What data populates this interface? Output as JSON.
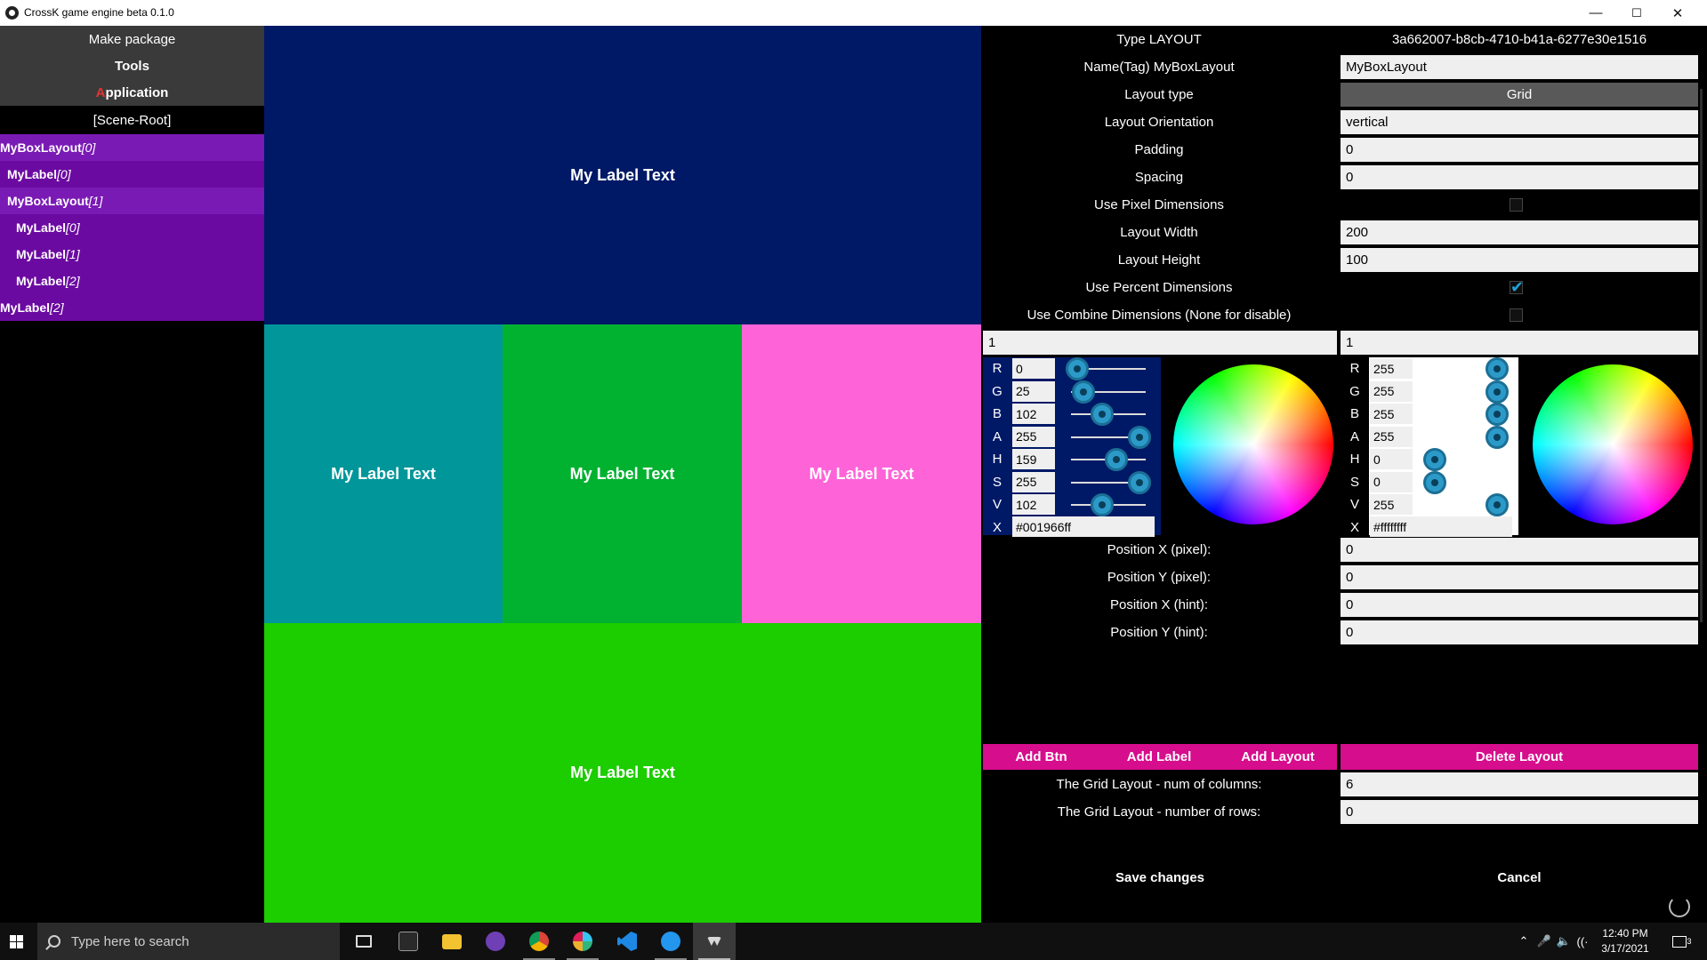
{
  "window": {
    "title": "CrossK game engine beta 0.1.0",
    "minimize": "—",
    "maximize": "☐",
    "close": "✕"
  },
  "left_panel": {
    "menu": {
      "make_package": "Make package",
      "tools": "Tools",
      "application_first": "A",
      "application_rest": "pplication"
    },
    "scene_root": "[Scene-Root]",
    "tree": [
      {
        "name": "MyBoxLayout",
        "index": "[0]"
      },
      {
        "name": "MyLabel",
        "index": "[0]"
      },
      {
        "name": "MyBoxLayout",
        "index": "[1]"
      },
      {
        "name": "MyLabel",
        "index": "[0]"
      },
      {
        "name": "MyLabel",
        "index": "[1]"
      },
      {
        "name": "MyLabel",
        "index": "[2]"
      },
      {
        "name": "MyLabel",
        "index": "[2]"
      }
    ]
  },
  "preview": {
    "label_text": "My Label Text",
    "colors": {
      "top": "#001966",
      "teal": "#00969a",
      "green": "#00b22f",
      "pink": "#ff63d8",
      "bottom": "#1ccd00"
    }
  },
  "inspector": {
    "type_label": "Type LAYOUT",
    "type_id": "3a662007-b8cb-4710-b41a-6277e30e1516",
    "name_label": "Name(Tag) MyBoxLayout",
    "name_value": "MyBoxLayout",
    "layout_type_label": "Layout type",
    "layout_type_value": "Grid",
    "orientation_label": "Layout Orientation",
    "orientation_value": "vertical",
    "padding_label": "Padding",
    "padding_value": "0",
    "spacing_label": "Spacing",
    "spacing_value": "0",
    "pixel_dims_label": "Use Pixel Dimensions",
    "pixel_dims_checked": false,
    "width_label": "Layout Width",
    "width_value": "200",
    "height_label": "Layout Height",
    "height_value": "100",
    "percent_dims_label": "Use Percent Dimensions",
    "percent_dims_checked": true,
    "combine_dims_label": "Use Combine Dimensions (None for disable)",
    "combine_dims_checked": false,
    "percent_left": "1",
    "percent_right": "1",
    "color_left": {
      "R": "0",
      "G": "25",
      "B": "102",
      "A": "255",
      "H": "159",
      "S": "255",
      "V": "102",
      "hex": "#001966ff"
    },
    "color_right": {
      "R": "255",
      "G": "255",
      "B": "255",
      "A": "255",
      "H": "0",
      "S": "0",
      "V": "255",
      "hex": "#ffffffff"
    },
    "channel_letters": [
      "R",
      "G",
      "B",
      "A",
      "H",
      "S",
      "V",
      "X"
    ],
    "pos_x_pixel_label": "Position X (pixel):",
    "pos_x_pixel_value": "0",
    "pos_y_pixel_label": "Position Y (pixel):",
    "pos_y_pixel_value": "0",
    "pos_x_hint_label": "Position X (hint):",
    "pos_x_hint_value": "0",
    "pos_y_hint_label": "Position Y (hint):",
    "pos_y_hint_value": "0",
    "add_btn": "Add Btn",
    "add_label": "Add Label",
    "add_layout": "Add Layout",
    "delete_layout": "Delete Layout",
    "grid_cols_label": "The Grid Layout - num of columns:",
    "grid_cols_value": "6",
    "grid_rows_label": "The Grid Layout - number of rows:",
    "grid_rows_value": "0",
    "save": "Save changes",
    "cancel": "Cancel"
  },
  "taskbar": {
    "search_placeholder": "Type here to search",
    "time": "12:40 PM",
    "date": "3/17/2021",
    "notification_count": "3"
  }
}
